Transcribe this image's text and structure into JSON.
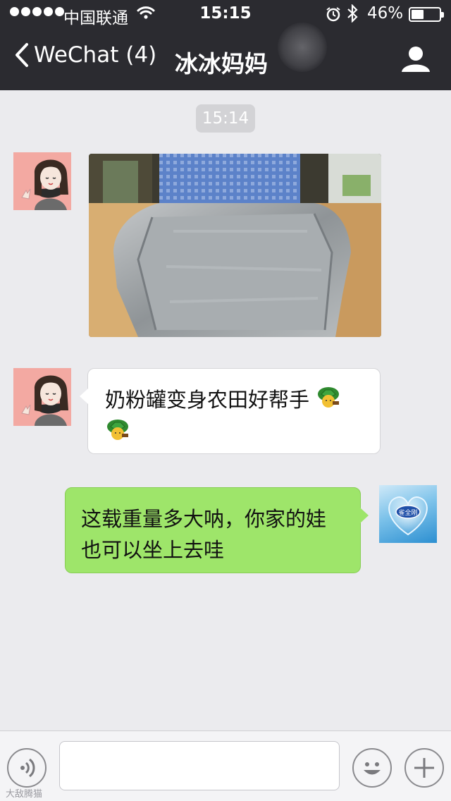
{
  "status_bar": {
    "carrier": "中国联通",
    "time": "15:15",
    "battery_percent": "46%",
    "battery_level": 0.46,
    "signal_dots": 5,
    "icons": [
      "wifi-icon",
      "alarm-icon",
      "bluetooth-icon",
      "battery-icon"
    ]
  },
  "nav": {
    "back_label": "WeChat",
    "unread_count": "(4)",
    "title": "冰冰妈妈",
    "icons": [
      "chevron-left-icon",
      "profile-icon"
    ]
  },
  "chat": {
    "timestamp": "15:14",
    "messages": [
      {
        "sender": "冰冰妈妈",
        "side": "left",
        "type": "image"
      },
      {
        "sender": "冰冰妈妈",
        "side": "left",
        "type": "text",
        "text": "奶粉罐变身农田好帮手",
        "trailing_emoji": "turtle-emoji"
      },
      {
        "sender": "me",
        "side": "right",
        "type": "text",
        "text": "这载重量多大呐，你家的娃也可以坐上去哇"
      }
    ],
    "brand_avatar_text": "雀全刚"
  },
  "input_bar": {
    "text_value": "",
    "icons": [
      "voice-icon",
      "emoji-icon",
      "plus-icon"
    ],
    "watermark": "大敌腾猫"
  },
  "colors": {
    "nav_background": "#2b2b30",
    "chat_background": "#ebebee",
    "sent_bubble": "#9ee56a",
    "received_bubble": "#ffffff"
  }
}
